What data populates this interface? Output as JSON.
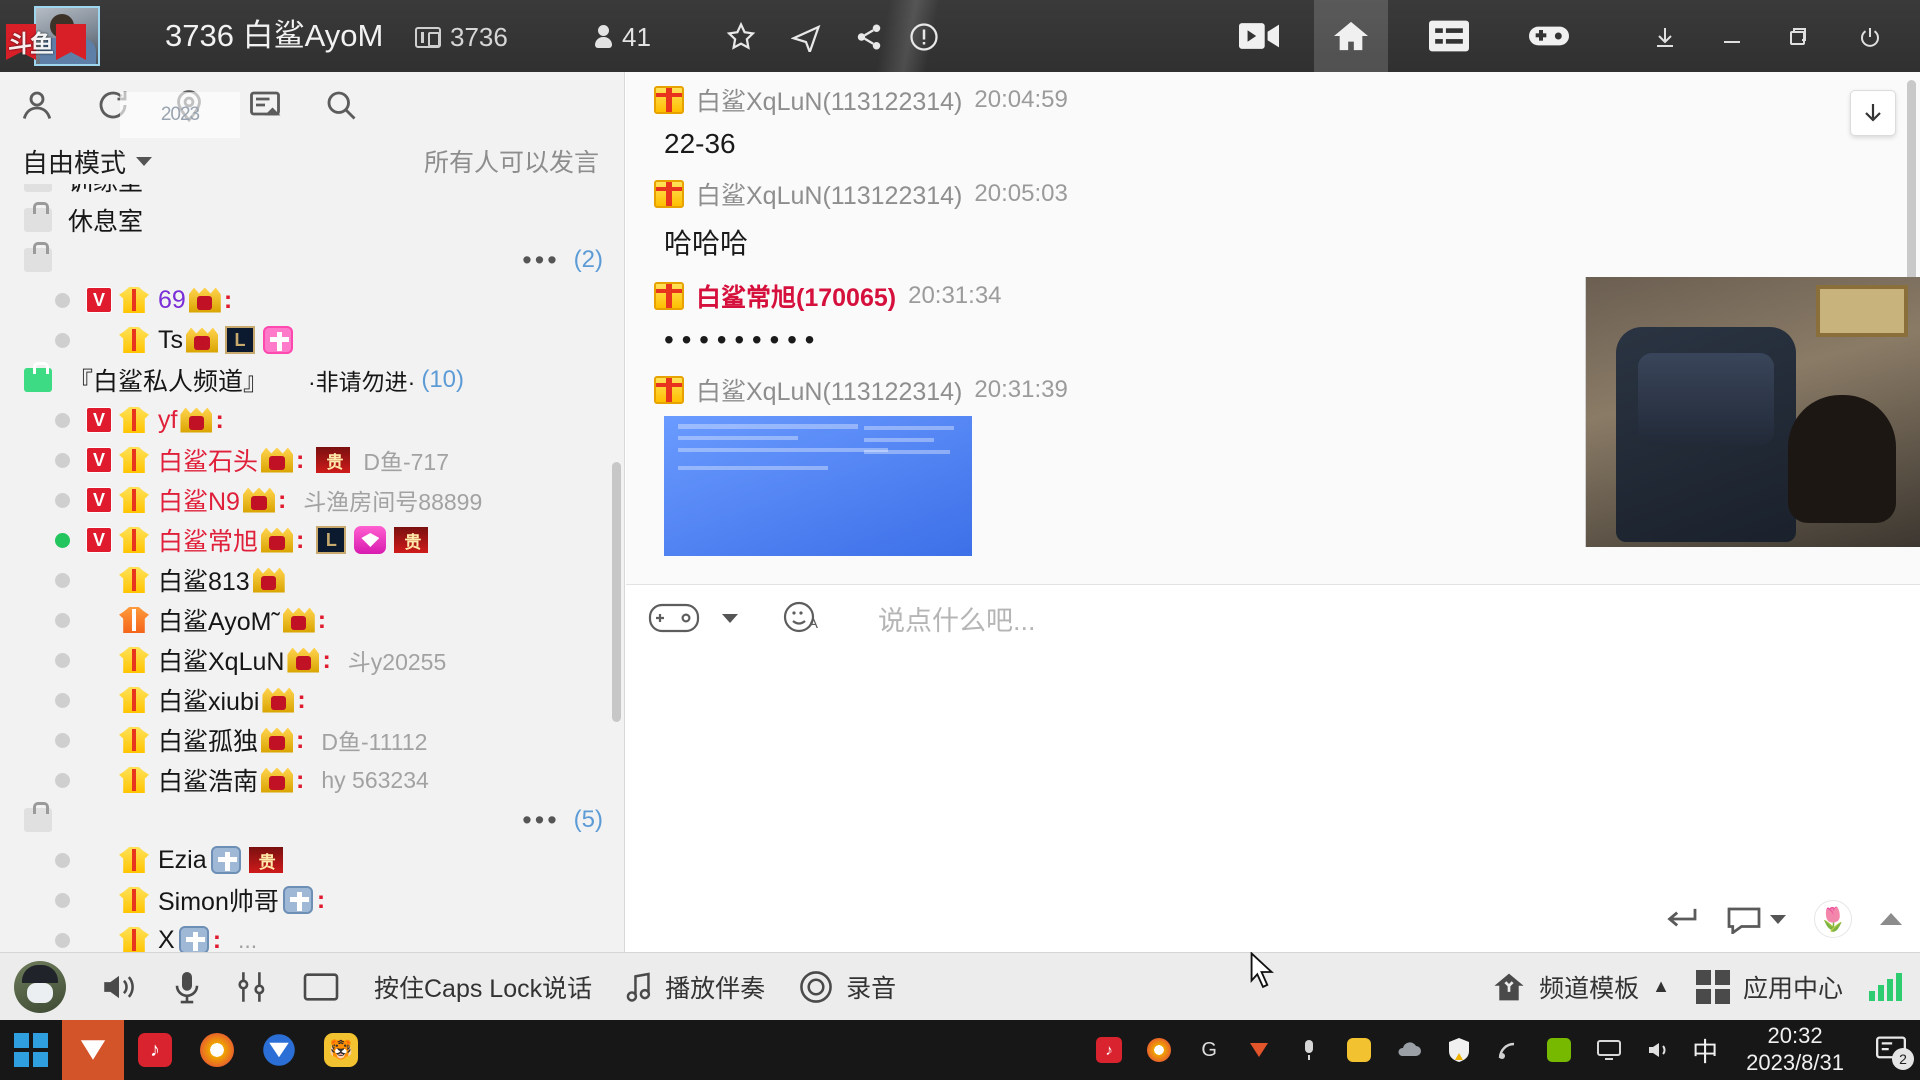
{
  "titlebar": {
    "room_number": "3736",
    "room_name": "白鲨AyoM",
    "id_label": "3736",
    "user_count": "41",
    "ribbon_text": "斗鱼",
    "icons": [
      "star-icon",
      "airplane-icon",
      "share-icon",
      "alert-icon"
    ],
    "tabs": [
      "video-tab",
      "home-tab",
      "list-tab",
      "game-tab"
    ],
    "window_controls": [
      "download-icon",
      "minimize-icon",
      "restore-icon",
      "power-icon"
    ]
  },
  "sidebar": {
    "tools": [
      "person-icon",
      "refresh-icon",
      "location-icon",
      "note-icon",
      "search-icon"
    ],
    "watermark": "2023",
    "mode_label": "自由模式",
    "permission_label": "所有人可以发言",
    "groups": [
      {
        "type": "channel",
        "name": "训练室",
        "note": "",
        "count": ""
      },
      {
        "type": "channel",
        "name": "休息室",
        "note": "",
        "count": ""
      },
      {
        "type": "channel",
        "name": "",
        "note": "",
        "count": "(2)"
      }
    ],
    "members_group1": [
      {
        "vip": true,
        "vest": "gold",
        "name": "69",
        "name_color": "purple",
        "badges": [
          "crown"
        ],
        "sub": "",
        "online": false
      },
      {
        "vip": false,
        "vest": "gold",
        "name": "Ts",
        "name_color": "black",
        "badges": [
          "crown",
          "lol",
          "pink"
        ],
        "sub": "",
        "online": false
      }
    ],
    "private_channel": {
      "name": "『白鲨私人频道』",
      "note": "·非请勿进·",
      "count": "(10)"
    },
    "members_group2": [
      {
        "vip": true,
        "vest": "gold",
        "name": "yf",
        "name_color": "red",
        "badges": [
          "crown"
        ],
        "sub": "",
        "online": false
      },
      {
        "vip": true,
        "vest": "gold",
        "name": "白鲨石头",
        "name_color": "red",
        "badges": [
          "crown",
          "noble"
        ],
        "sub": "D鱼-717",
        "online": false
      },
      {
        "vip": true,
        "vest": "gold",
        "name": "白鲨N9",
        "name_color": "red",
        "badges": [
          "crown"
        ],
        "sub": "斗渔房间号88899",
        "online": false
      },
      {
        "vip": true,
        "vest": "gold",
        "name": "白鲨常旭",
        "name_color": "red",
        "badges": [
          "crown",
          "lol",
          "gem",
          "noble"
        ],
        "sub": "",
        "online": true
      },
      {
        "vip": false,
        "vest": "gold",
        "name": "白鲨813",
        "name_color": "black",
        "badges": [
          "crown"
        ],
        "sub": "",
        "online": false
      },
      {
        "vip": false,
        "vest": "org",
        "name": "白鲨AyoM˜",
        "name_color": "black",
        "badges": [
          "crown"
        ],
        "sub": "",
        "online": false
      },
      {
        "vip": false,
        "vest": "gold",
        "name": "白鲨XqLuN",
        "name_color": "black",
        "badges": [
          "crown"
        ],
        "sub": "斗y20255",
        "online": false
      },
      {
        "vip": false,
        "vest": "gold",
        "name": "白鲨xiubi",
        "name_color": "black",
        "badges": [
          "crown"
        ],
        "sub": "",
        "online": false
      },
      {
        "vip": false,
        "vest": "gold",
        "name": "白鲨孤独",
        "name_color": "black",
        "badges": [
          "crown"
        ],
        "sub": "D鱼-11112",
        "online": false
      },
      {
        "vip": false,
        "vest": "gold",
        "name": "白鲨浩南",
        "name_color": "black",
        "badges": [
          "crown"
        ],
        "sub": "hy 563234",
        "online": false
      }
    ],
    "group3_count": "(5)",
    "members_group3": [
      {
        "vip": false,
        "vest": "gold",
        "name": "Ezia",
        "name_color": "black",
        "badges": [
          "hat",
          "noble"
        ],
        "sub": "",
        "online": false
      },
      {
        "vip": false,
        "vest": "gold",
        "name": "Simon帅哥",
        "name_color": "black",
        "badges": [
          "hat",
          "crown2"
        ],
        "sub": "",
        "online": false
      },
      {
        "vip": false,
        "vest": "gold",
        "name": "X",
        "name_color": "black",
        "badges": [
          "hat"
        ],
        "sub": "...",
        "online": false
      }
    ],
    "ellipsis": "•••"
  },
  "chat": {
    "messages": [
      {
        "user": "白鲨XqLuN",
        "uid": "(113122314)",
        "color": "gray",
        "time": "20:04:59",
        "text": "22-36",
        "image": false
      },
      {
        "user": "白鲨XqLuN",
        "uid": "(113122314)",
        "color": "gray",
        "time": "20:05:03",
        "text": "哈哈哈",
        "image": false
      },
      {
        "user": "白鲨常旭",
        "uid": "(170065)",
        "color": "red",
        "time": "20:31:34",
        "text": "• • • • • • • • •",
        "image": false
      },
      {
        "user": "白鲨XqLuN",
        "uid": "(113122314)",
        "color": "gray",
        "time": "20:31:39",
        "text": "",
        "image": true
      }
    ],
    "jump_icon": "scroll-to-bottom-icon"
  },
  "composer": {
    "game_icon": "gamepad-icon",
    "emoji_icon": "emoji-icon",
    "placeholder": "说点什么吧...",
    "send_icon": "enter-icon",
    "chat_icon": "speech-bubble-icon",
    "flower_icon": "tulip-icon",
    "collapse_icon": "chevron-up-icon"
  },
  "bottombar": {
    "avatar": "user-avatar",
    "speaker_icon": "speaker-icon",
    "mic_icon": "microphone-icon",
    "mixer_icon": "mixer-icon",
    "screen_icon": "screen-icon",
    "ptt_label": "按住Caps Lock说话",
    "music_icon": "music-note-icon",
    "music_label": "播放伴奏",
    "record_icon": "record-icon",
    "record_label": "录音",
    "template_icon": "home-badge-icon",
    "template_label": "频道模板",
    "template_caret": "▲",
    "apps_icon": "grid-icon",
    "apps_label": "应用中心",
    "signal_icon": "signal-bars-icon"
  },
  "taskbar": {
    "start_icon": "windows-start-icon",
    "pinned": [
      "yy-icon",
      "netease-music-icon",
      "chrome-icon",
      "yy-voice-icon",
      "panda-icon"
    ],
    "tray": [
      "netease-icon",
      "chrome-icon",
      "logitech-icon",
      "yy-icon",
      "mic-icon",
      "panda-icon",
      "cloud-icon",
      "shield-warn-icon",
      "satellite-icon",
      "nvidia-icon",
      "monitor-icon",
      "volume-icon"
    ],
    "ime_label": "中",
    "time": "20:32",
    "date": "2023/8/31",
    "notif_count": "2"
  },
  "colors": {
    "accent_red": "#e0203a",
    "online_green": "#22c55e",
    "link_blue": "#5c9bd6",
    "titlebar_bg": "#333333"
  }
}
